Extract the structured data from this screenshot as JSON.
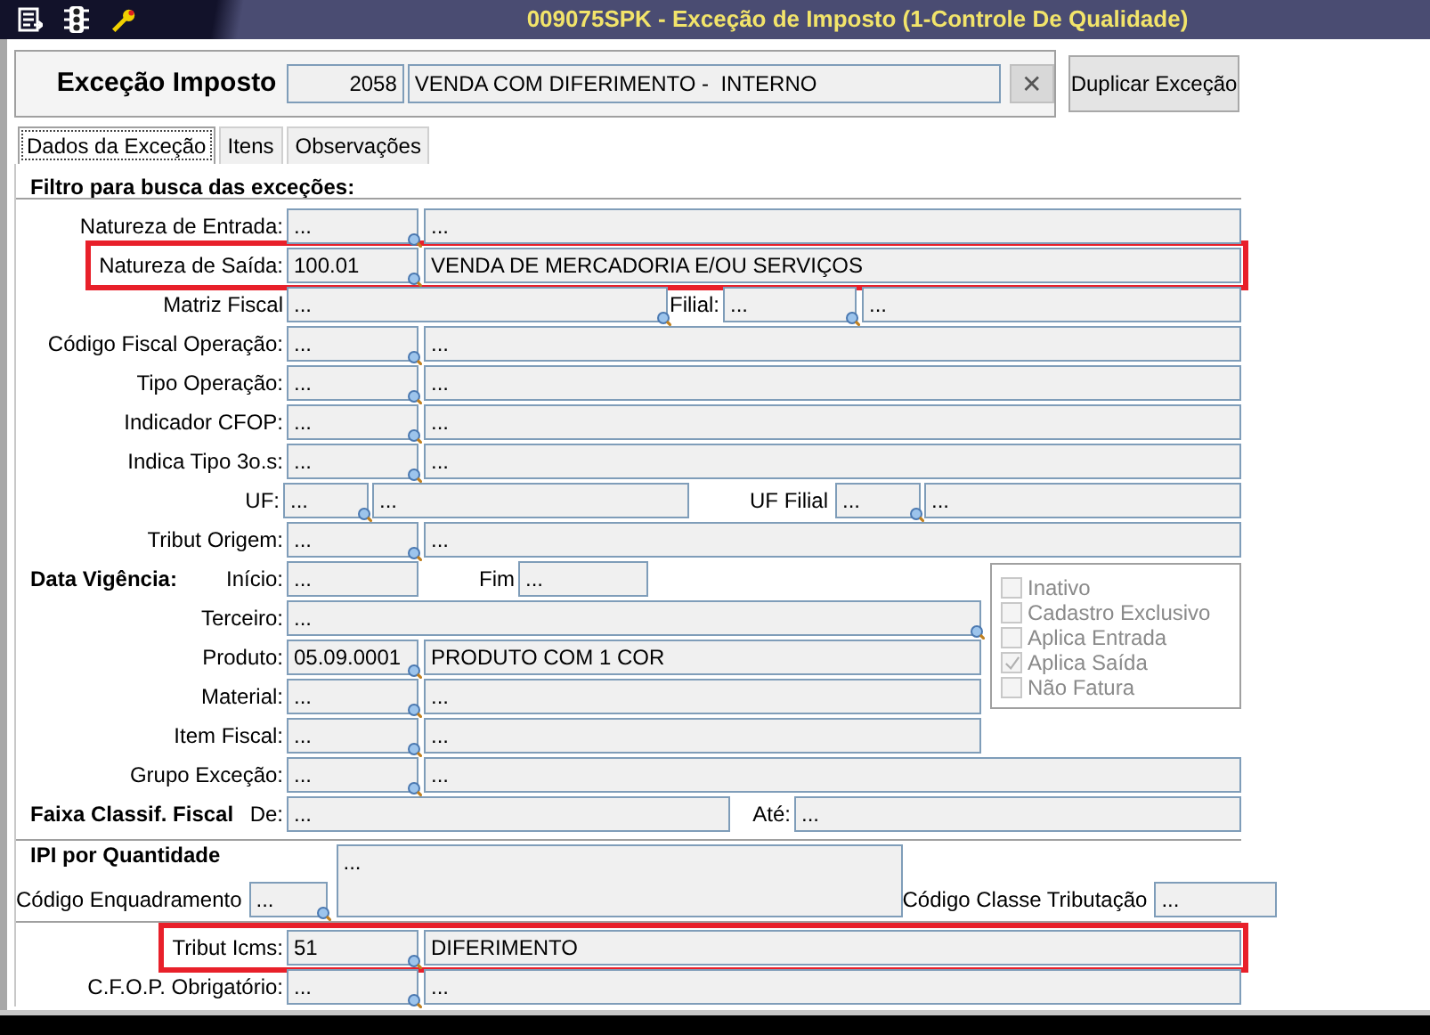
{
  "window": {
    "title": "009075SPK - Exceção de Imposto (1-Controle De Qualidade)"
  },
  "header": {
    "label": "Exceção Imposto",
    "code": "2058",
    "description": "VENDA COM DIFERIMENTO -  INTERNO",
    "clear_button": "✕",
    "duplicate_button": "Duplicar Exceção"
  },
  "tabs": [
    {
      "label": "Dados da Exceção",
      "selected": true
    },
    {
      "label": "Itens",
      "selected": false
    },
    {
      "label": "Observações",
      "selected": false
    }
  ],
  "filter_title": "Filtro para busca das exceções:",
  "filter_rows": [
    {
      "kind": "pair",
      "label": "Natureza de Entrada:",
      "highlighted": false,
      "fields": [
        {
          "value": "...",
          "lookup": true
        },
        {
          "value": "..."
        }
      ]
    },
    {
      "kind": "pair",
      "label": "Natureza de Saída:",
      "highlighted": true,
      "fields": [
        {
          "value": "100.01",
          "lookup": true
        },
        {
          "value": "VENDA DE MERCADORIA E/OU SERVIÇOS"
        }
      ]
    },
    {
      "kind": "matriz",
      "label": "Matriz Fiscal",
      "label2": "Filial:",
      "highlighted": false,
      "fields": [
        {
          "value": "...",
          "lookup": true
        },
        {
          "value": "...",
          "lookup": true
        },
        {
          "value": "..."
        }
      ]
    },
    {
      "kind": "pair",
      "label": "Código Fiscal Operação:",
      "highlighted": false,
      "fields": [
        {
          "value": "...",
          "lookup": true
        },
        {
          "value": "..."
        }
      ]
    },
    {
      "kind": "pair",
      "label": "Tipo Operação:",
      "highlighted": false,
      "fields": [
        {
          "value": "...",
          "lookup": true
        },
        {
          "value": "..."
        }
      ]
    },
    {
      "kind": "pair",
      "label": "Indicador CFOP:",
      "highlighted": false,
      "fields": [
        {
          "value": "...",
          "lookup": true
        },
        {
          "value": "..."
        }
      ]
    },
    {
      "kind": "pair",
      "label": "Indica Tipo 3o.s:",
      "highlighted": false,
      "fields": [
        {
          "value": "...",
          "lookup": true
        },
        {
          "value": "..."
        }
      ]
    },
    {
      "kind": "uf",
      "label": "UF:",
      "label2": "UF Filial",
      "highlighted": false,
      "fields": [
        {
          "value": "...",
          "lookup": true
        },
        {
          "value": "..."
        },
        {
          "value": "...",
          "lookup": true
        },
        {
          "value": "..."
        }
      ]
    },
    {
      "kind": "pair",
      "label": "Tribut Origem:",
      "highlighted": false,
      "fields": [
        {
          "value": "...",
          "lookup": true
        },
        {
          "value": "..."
        }
      ]
    }
  ],
  "validity_rows": [
    {
      "kind": "dates",
      "section": "Data Vigência:",
      "label": "Início:",
      "label2": "Fim",
      "fields": [
        {
          "value": "..."
        },
        {
          "value": "..."
        }
      ]
    },
    {
      "kind": "single",
      "label": "Terceiro:",
      "highlighted": false,
      "fields": [
        {
          "value": "...",
          "lookup": true
        }
      ]
    },
    {
      "kind": "pair",
      "label": "Produto:",
      "highlighted": false,
      "fields": [
        {
          "value": "05.09.0001",
          "lookup": true
        },
        {
          "value": "PRODUTO COM 1 COR"
        }
      ]
    },
    {
      "kind": "pair",
      "label": "Material:",
      "highlighted": false,
      "fields": [
        {
          "value": "...",
          "lookup": true
        },
        {
          "value": "..."
        }
      ]
    },
    {
      "kind": "pair",
      "label": "Item Fiscal:",
      "highlighted": false,
      "fields": [
        {
          "value": "...",
          "lookup": true
        },
        {
          "value": "..."
        }
      ]
    }
  ],
  "options": [
    {
      "label": "Inativo",
      "checked": false,
      "disabled": true
    },
    {
      "label": "Cadastro Exclusivo",
      "checked": false,
      "disabled": true
    },
    {
      "label": "Aplica Entrada",
      "checked": false,
      "disabled": true
    },
    {
      "label": "Aplica Saída",
      "checked": true,
      "disabled": true
    },
    {
      "label": "Não Fatura",
      "checked": false,
      "disabled": true
    }
  ],
  "lower_rows": [
    {
      "kind": "pair",
      "label": "Grupo Exceção:",
      "highlighted": false,
      "fields": [
        {
          "value": "...",
          "lookup": true
        },
        {
          "value": "..."
        }
      ]
    },
    {
      "kind": "range",
      "section": "Faixa Classif. Fiscal",
      "label": "De:",
      "label2": "Até:",
      "fields": [
        {
          "value": "..."
        },
        {
          "value": "..."
        }
      ]
    }
  ],
  "ipi": {
    "title": "IPI por Quantidade",
    "description": "...",
    "code_label": "Código Enquadramento",
    "code": "...",
    "class_label": "Código Classe Tributação",
    "class_value": "..."
  },
  "bottom_rows": [
    {
      "kind": "pair",
      "label": "Tribut Icms:",
      "highlighted": true,
      "fields": [
        {
          "value": "51",
          "lookup": true
        },
        {
          "value": "DIFERIMENTO"
        }
      ]
    },
    {
      "kind": "pair",
      "label": "C.F.O.P. Obrigatório:",
      "highlighted": false,
      "fields": [
        {
          "value": "...",
          "lookup": true
        },
        {
          "value": "..."
        }
      ]
    }
  ]
}
